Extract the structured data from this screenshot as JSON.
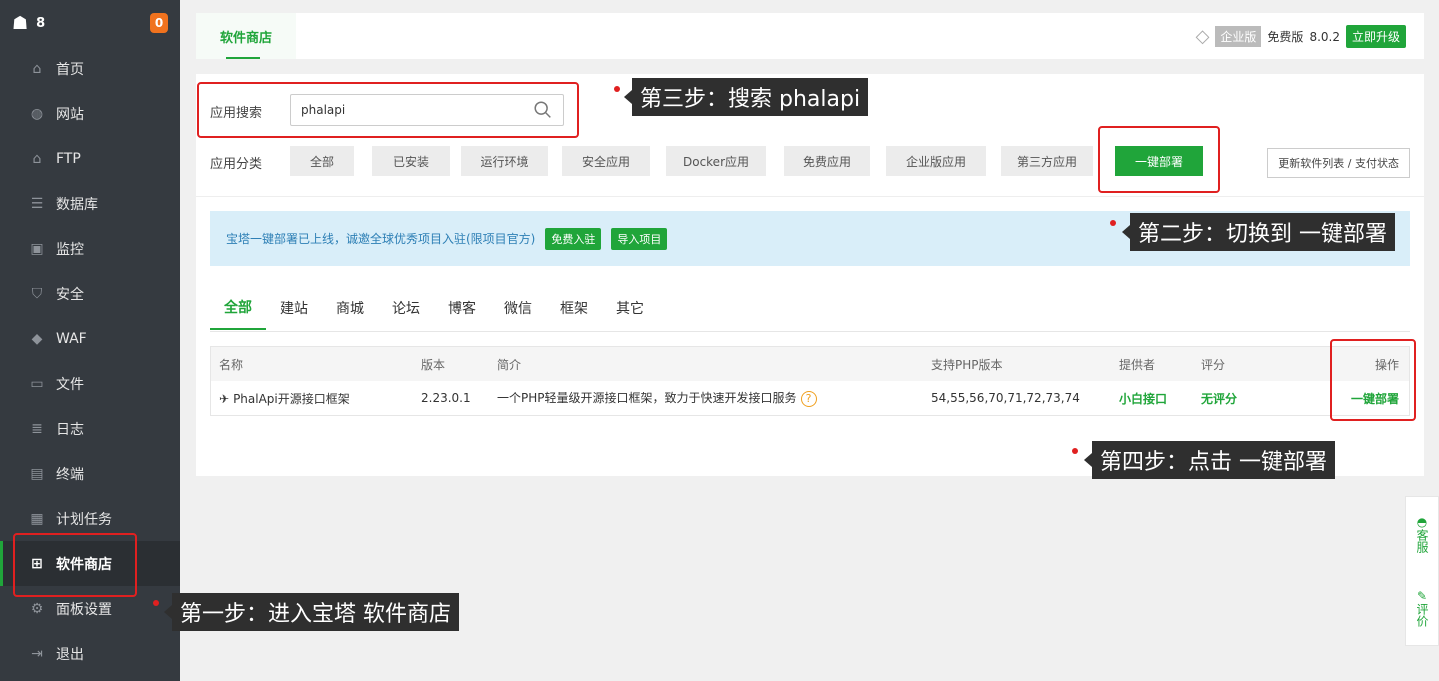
{
  "sidebar": {
    "server_name": "8",
    "badge": "0",
    "items": [
      {
        "label": "首页",
        "icon": "home-icon"
      },
      {
        "label": "网站",
        "icon": "globe-icon"
      },
      {
        "label": "FTP",
        "icon": "ftp-icon"
      },
      {
        "label": "数据库",
        "icon": "database-icon"
      },
      {
        "label": "监控",
        "icon": "monitor-icon"
      },
      {
        "label": "安全",
        "icon": "shield-icon"
      },
      {
        "label": "WAF",
        "icon": "waf-shield-icon"
      },
      {
        "label": "文件",
        "icon": "folder-icon"
      },
      {
        "label": "日志",
        "icon": "log-icon"
      },
      {
        "label": "终端",
        "icon": "terminal-icon"
      },
      {
        "label": "计划任务",
        "icon": "calendar-icon"
      },
      {
        "label": "软件商店",
        "icon": "apps-grid-icon",
        "active": true
      },
      {
        "label": "面板设置",
        "icon": "gear-icon"
      },
      {
        "label": "退出",
        "icon": "logout-icon"
      }
    ]
  },
  "header": {
    "tab": "软件商店",
    "edition_tag": "企业版",
    "free_label": "免费版",
    "version": "8.0.2",
    "upgrade": "立即升级"
  },
  "search": {
    "label": "应用搜索",
    "value": "phalapi"
  },
  "categories": {
    "label": "应用分类",
    "items": [
      "全部",
      "已安装",
      "运行环境",
      "安全应用",
      "Docker应用",
      "免费应用",
      "企业版应用",
      "第三方应用",
      "一键部署"
    ],
    "active": "一键部署",
    "refresh": "更新软件列表 / 支付状态"
  },
  "notice": {
    "text": "宝塔一键部署已上线，诚邀全球优秀项目入驻(限项目官方)",
    "btn_join": "免费入驻",
    "btn_import": "导入项目"
  },
  "subtabs": [
    "全部",
    "建站",
    "商城",
    "论坛",
    "博客",
    "微信",
    "框架",
    "其它"
  ],
  "table": {
    "headers": {
      "name": "名称",
      "version": "版本",
      "desc": "简介",
      "php": "支持PHP版本",
      "provider": "提供者",
      "rating": "评分",
      "action": "操作"
    },
    "rows": [
      {
        "name": "PhalApi开源接口框架",
        "version": "2.23.0.1",
        "desc": "一个PHP轻量级开源接口框架，致力于快速开发接口服务",
        "php": "54,55,56,70,71,72,73,74",
        "provider": "小白接口",
        "rating": "无评分",
        "action": "一键部署"
      }
    ]
  },
  "annotations": {
    "step1": "第一步：进入宝塔 软件商店",
    "step2": "第二步：切换到 一键部署",
    "step3": "第三步：搜索 phalapi",
    "step4": "第四步：点击 一键部署"
  },
  "floatbar": {
    "service": "客服",
    "rate": "评价"
  }
}
